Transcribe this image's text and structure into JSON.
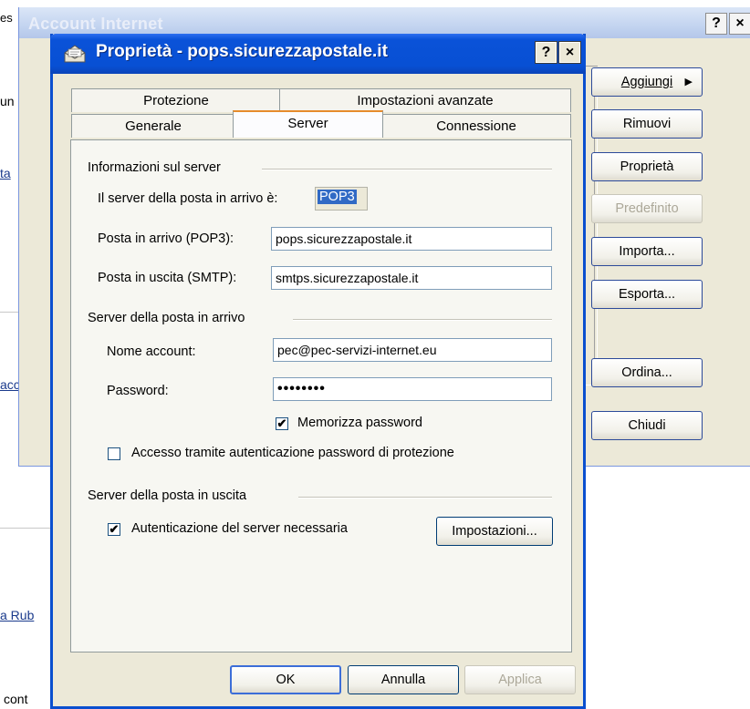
{
  "background": {
    "fragments": [
      "es",
      "un",
      "ta",
      "acc",
      "a Rub",
      "cont"
    ]
  },
  "back_window": {
    "title": "Account Internet",
    "help": "?",
    "close": "×",
    "buttons": {
      "add": "Aggiungi",
      "remove": "Rimuovi",
      "properties": "Proprietà",
      "default": "Predefinito",
      "import": "Importa...",
      "export": "Esporta...",
      "sort": "Ordina...",
      "close": "Chiudi"
    }
  },
  "dialog": {
    "title": "Proprietà - pops.sicurezzapostale.it",
    "help": "?",
    "close": "×",
    "tabs": {
      "security": "Protezione",
      "advanced": "Impostazioni avanzate",
      "general": "Generale",
      "server": "Server",
      "connection": "Connessione"
    },
    "server_info": {
      "heading": "Informazioni sul server",
      "incoming_type_label": "Il server della posta in arrivo è:",
      "incoming_type_value": "POP3",
      "incoming_label": "Posta in arrivo (POP3):",
      "incoming_value": "pops.sicurezzapostale.it",
      "outgoing_label": "Posta in uscita (SMTP):",
      "outgoing_value": "smtps.sicurezzapostale.it"
    },
    "incoming_server": {
      "heading": "Server della posta in arrivo",
      "account_label": "Nome account:",
      "account_value": "pec@pec-servizi-internet.eu",
      "password_label": "Password:",
      "password_value": "••••••••",
      "remember_label": "Memorizza password",
      "remember_checked": true,
      "spa_label": "Accesso tramite autenticazione password di protezione",
      "spa_checked": false
    },
    "outgoing_server": {
      "heading": "Server della posta in uscita",
      "auth_label": "Autenticazione del server necessaria",
      "auth_checked": true,
      "settings_button": "Impostazioni..."
    },
    "footer": {
      "ok": "OK",
      "cancel": "Annulla",
      "apply": "Applica"
    }
  }
}
